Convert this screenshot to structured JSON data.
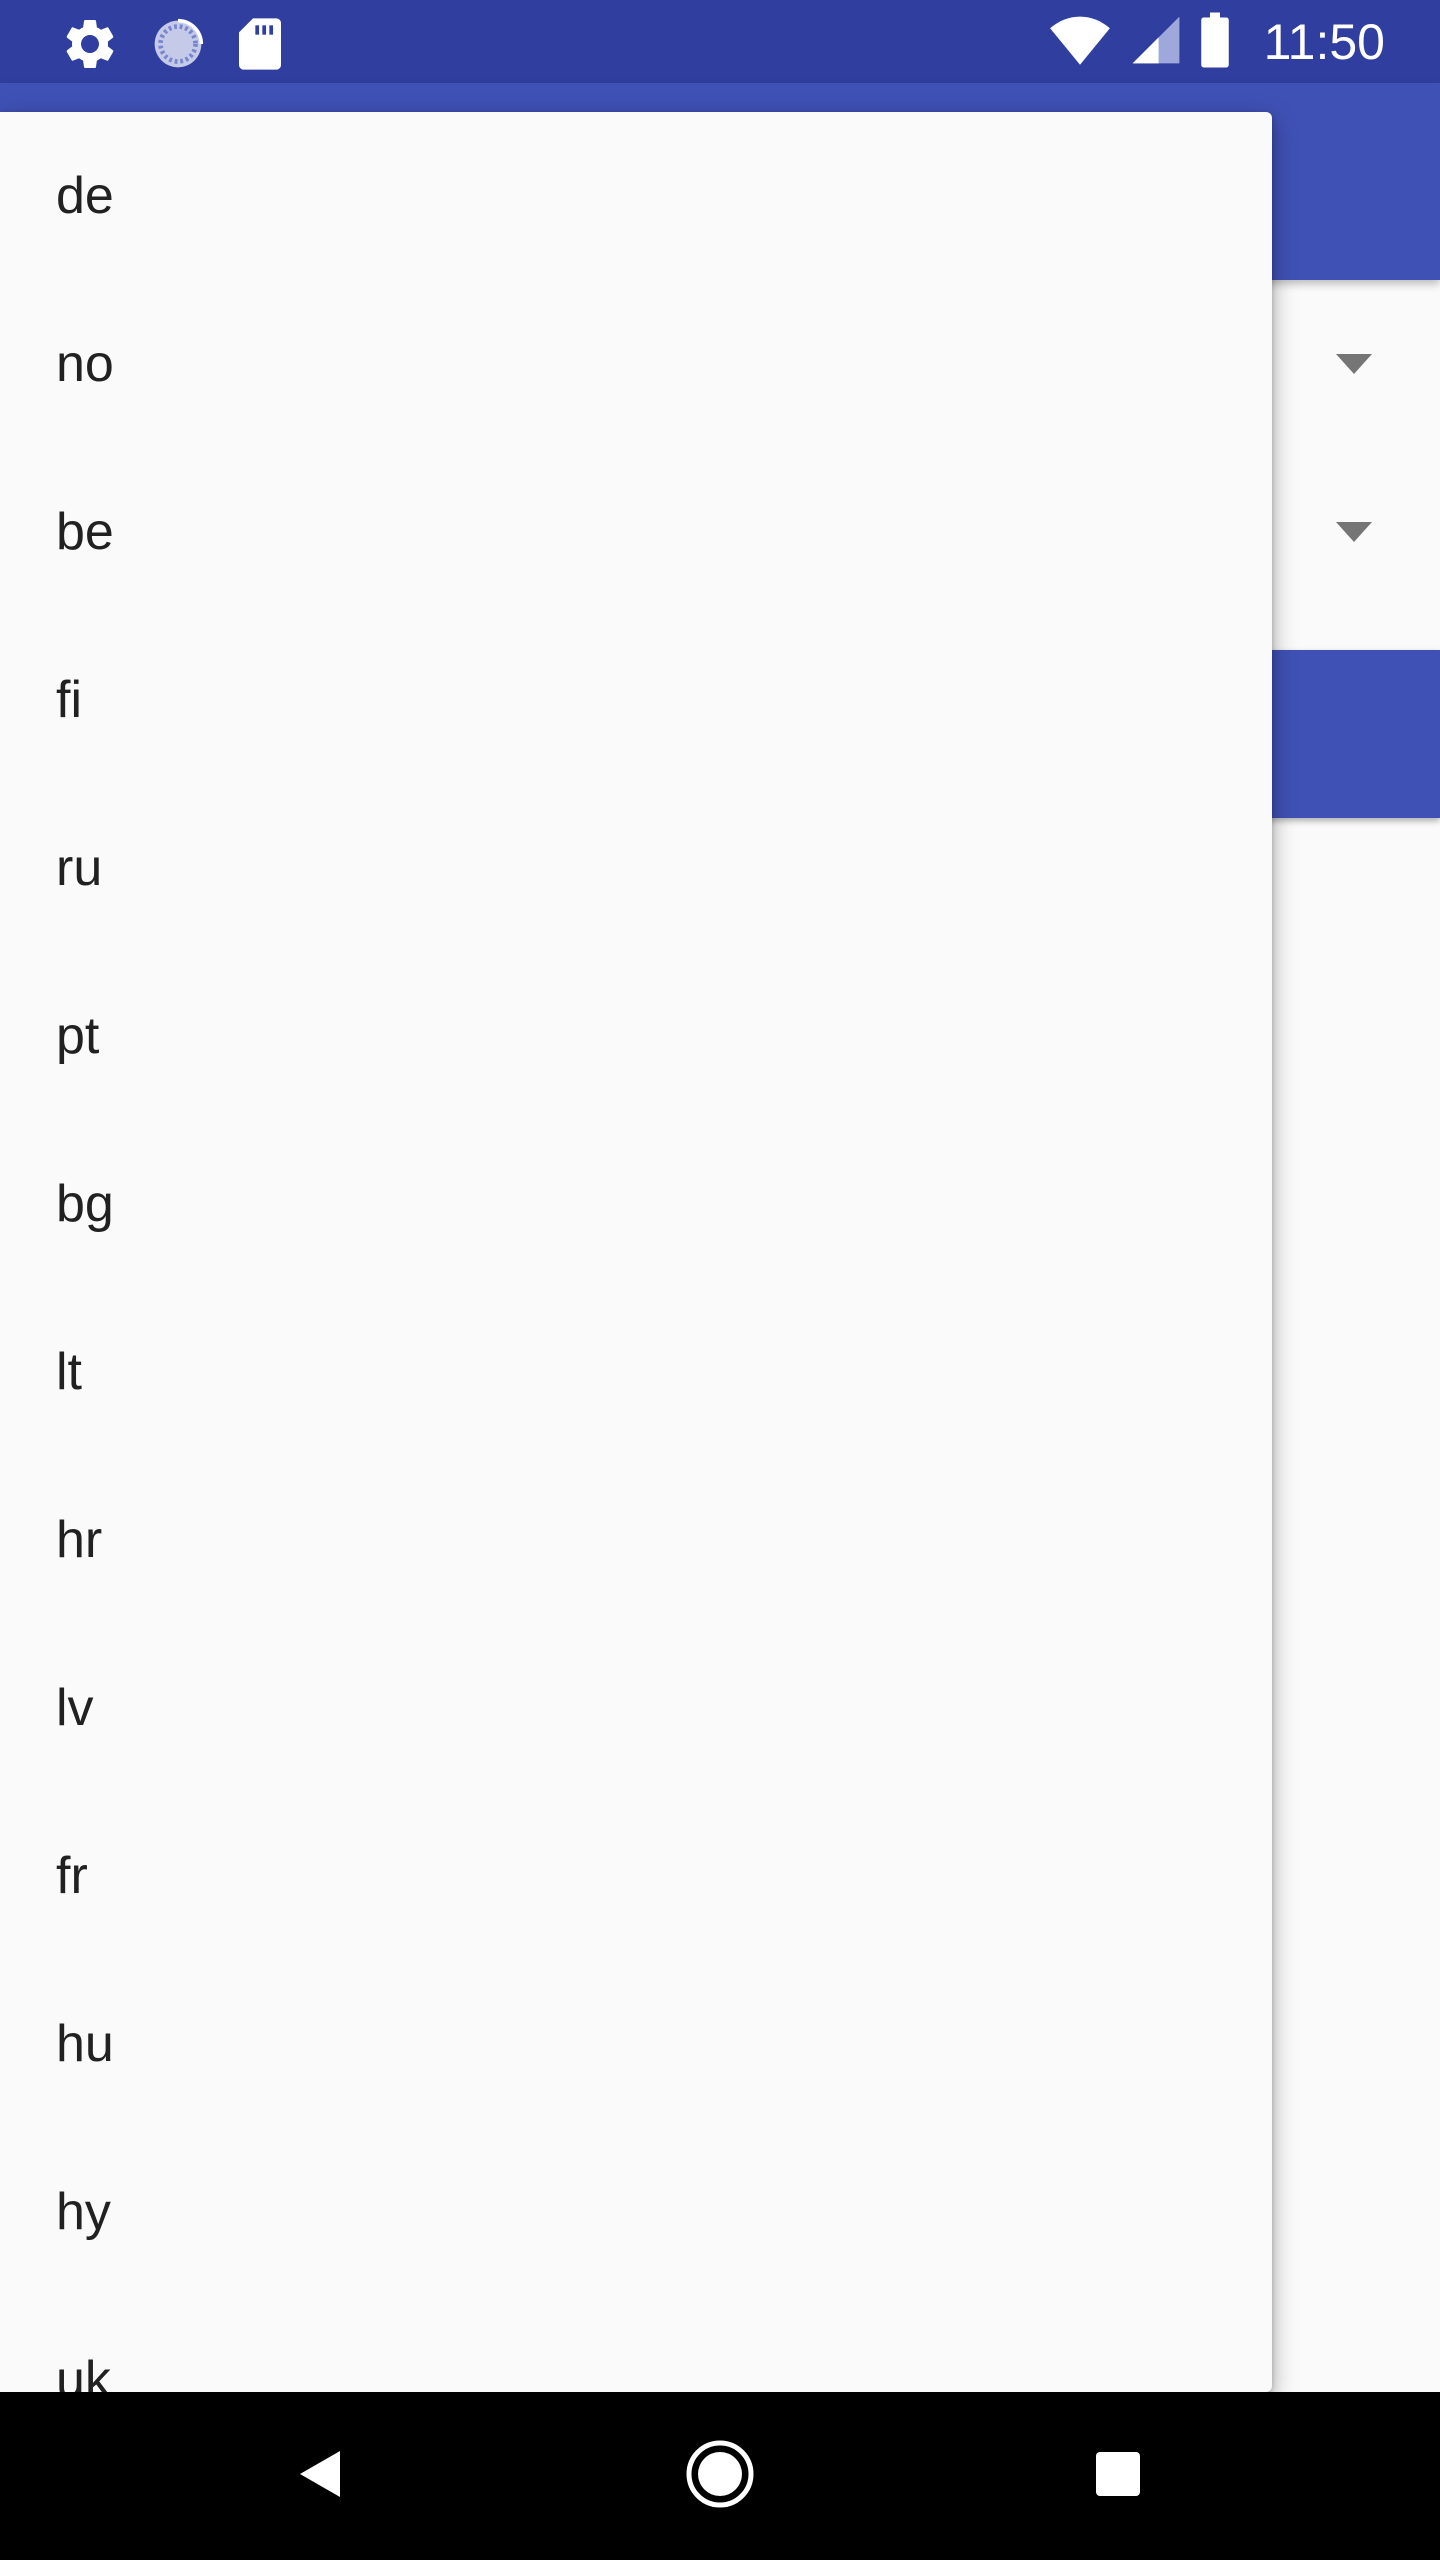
{
  "status_bar": {
    "time": "11:50",
    "icons_left": [
      "settings-icon",
      "sync-icon",
      "sd-card-icon"
    ],
    "icons_right": [
      "wifi-icon",
      "cellular-signal-icon",
      "battery-icon"
    ]
  },
  "dropdown": {
    "items": [
      "de",
      "no",
      "be",
      "fi",
      "ru",
      "pt",
      "bg",
      "lt",
      "hr",
      "lv",
      "fr",
      "hu",
      "hy",
      "uk"
    ]
  },
  "nav_bar": {
    "buttons": [
      "back-icon",
      "home-icon",
      "recents-icon"
    ]
  },
  "colors": {
    "status_bar": "#303f9f",
    "primary": "#3f51b5",
    "surface": "#fafafa",
    "text": "#212121",
    "nav_bar": "#000000"
  }
}
